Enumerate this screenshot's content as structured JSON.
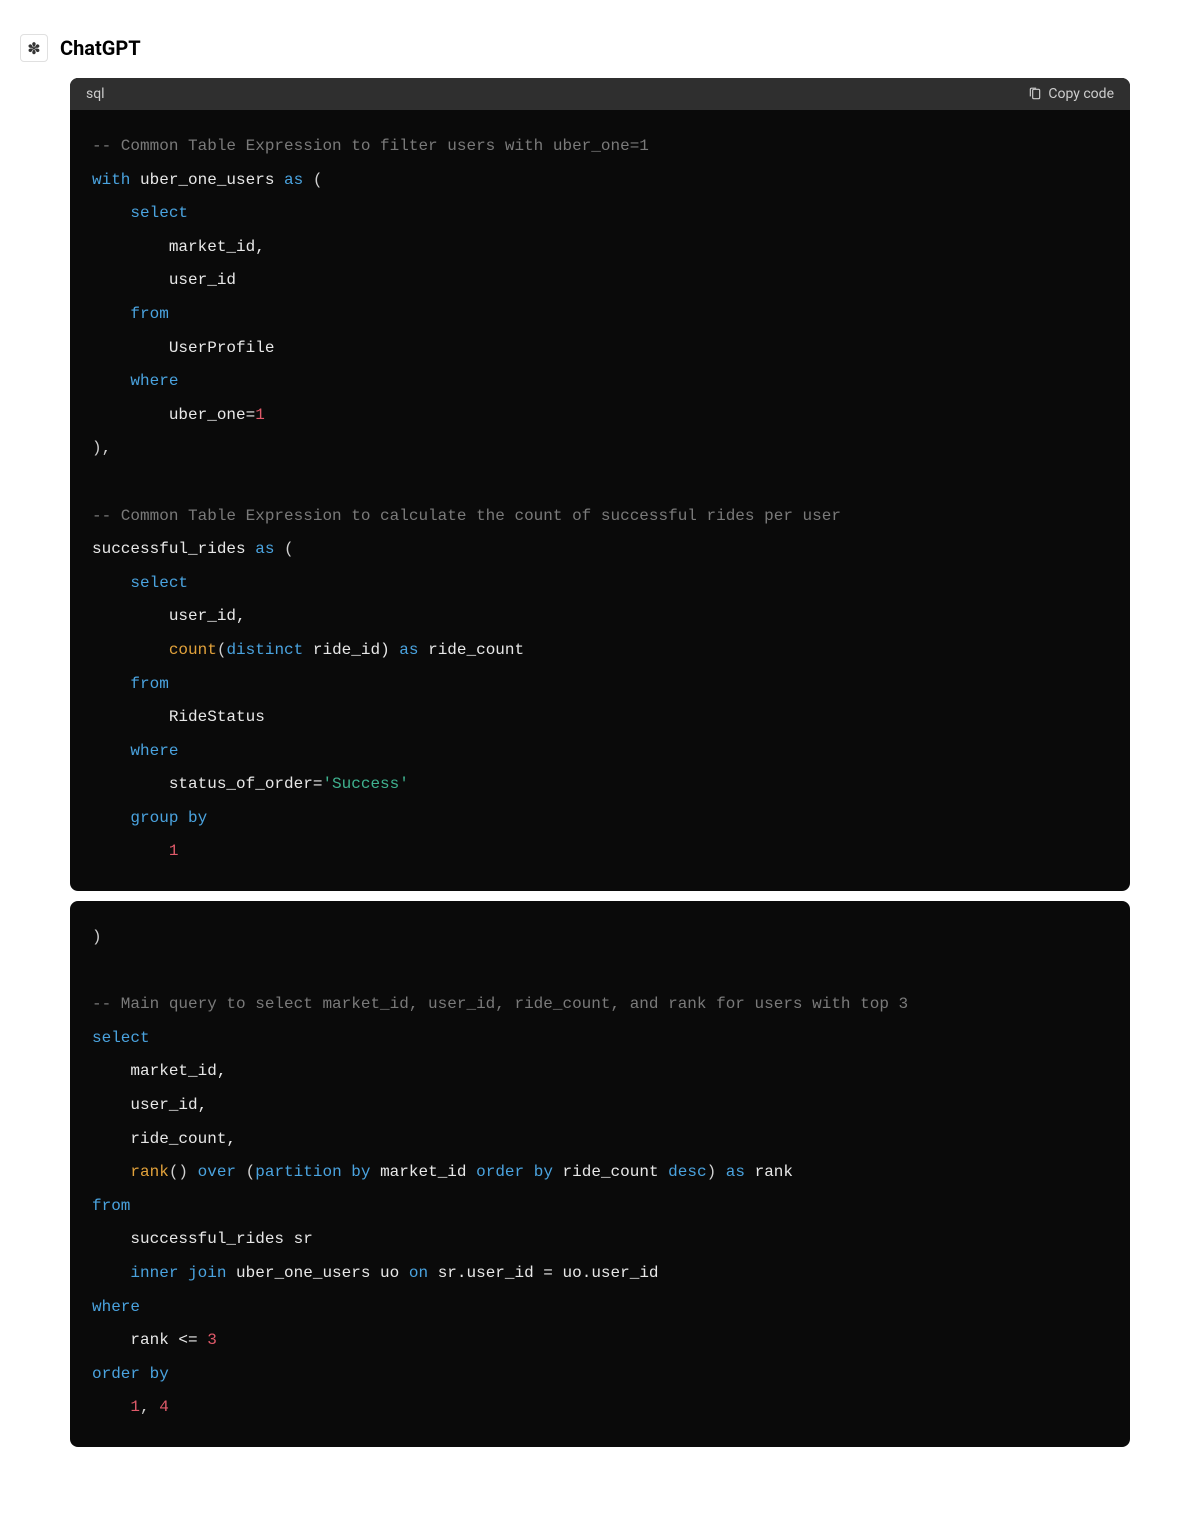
{
  "header": {
    "logo_glyph": "✽",
    "app_title": "ChatGPT"
  },
  "block1": {
    "lang": "sql",
    "copy_label": "Copy code",
    "code": {
      "c1": "-- Common Table Expression to filter users with uber_one=1",
      "k_with": "with",
      "id_uou": "uber_one_users",
      "k_as1": "as",
      "op_lp1": "(",
      "k_select1": "select",
      "id_mkt": "market_id,",
      "id_uid": "user_id",
      "k_from1": "from",
      "id_up": "UserProfile",
      "k_where1": "where",
      "id_uo": "uber_one=",
      "n_1a": "1",
      "op_rp1": "),",
      "c2": "-- Common Table Expression to calculate the count of successful rides per user",
      "id_sr": "successful_rides",
      "k_as2": "as",
      "op_lp2": "(",
      "k_select2": "select",
      "id_uid2": "user_id,",
      "f_count": "count",
      "op_lp3": "(",
      "k_distinct": "distinct",
      "id_ride": "ride_id)",
      "k_as3": "as",
      "id_rc": "ride_count",
      "k_from2": "from",
      "id_rs": "RideStatus",
      "k_where2": "where",
      "id_soo": "status_of_order=",
      "s_success": "'Success'",
      "k_group": "group by",
      "n_gb1": "1"
    }
  },
  "block2": {
    "code": {
      "op_rp2": ")",
      "c3": "-- Main query to select market_id, user_id, ride_count, and rank for users with top 3",
      "k_select3": "select",
      "id_mkt2": "market_id,",
      "id_uid3": "user_id,",
      "id_rc2": "ride_count,",
      "f_rank": "rank",
      "op_rc": "()",
      "k_over": "over",
      "op_lp4": "(",
      "k_part": "partition by",
      "id_mkt3": "market_id",
      "k_order": "order by",
      "id_rc3": "ride_count",
      "k_desc": "desc",
      "op_rp4": ")",
      "k_as4": "as",
      "id_rank": "rank",
      "k_from3": "from",
      "id_sr2": "successful_rides sr",
      "k_inner": "inner join",
      "id_uou2": "uber_one_users uo",
      "k_on": "on",
      "id_join": "sr.user_id = uo.user_id",
      "k_where3": "where",
      "id_cond": "rank <= ",
      "n_3": "3",
      "k_order2": "order by",
      "n_o1": "1",
      "op_comma": ", ",
      "n_o4": "4"
    }
  }
}
